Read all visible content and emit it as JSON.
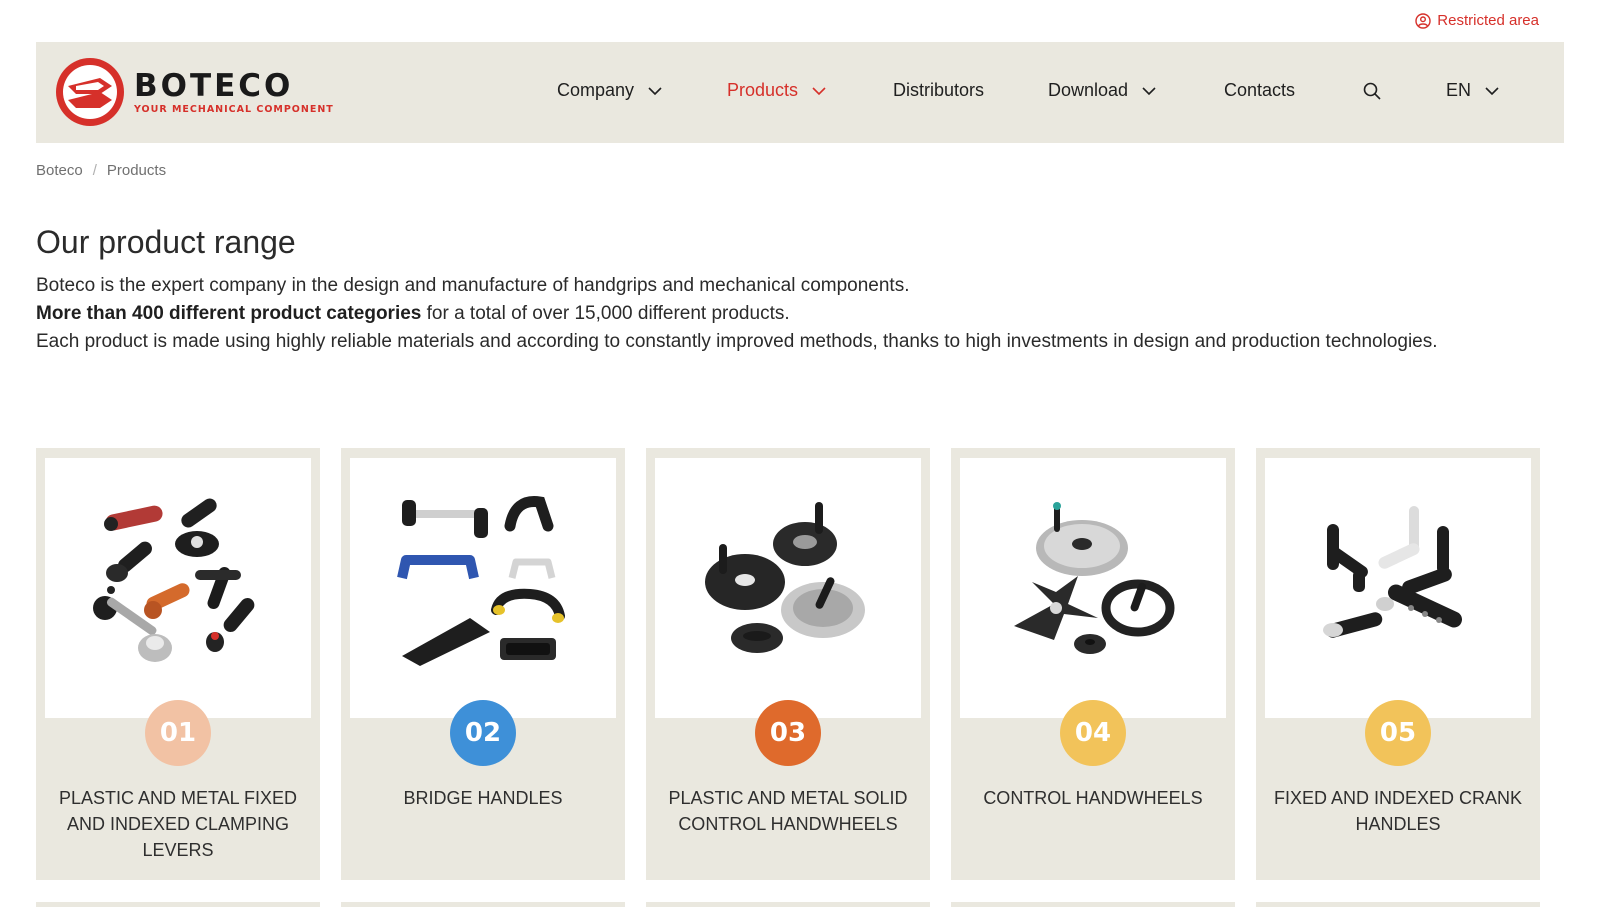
{
  "topbar": {
    "restricted_label": "Restricted area"
  },
  "brand": {
    "name": "BOTECO",
    "tagline": "YOUR MECHANICAL COMPONENT",
    "accent": "#d6302a"
  },
  "nav": {
    "company": "Company",
    "products": "Products",
    "distributors": "Distributors",
    "download": "Download",
    "contacts": "Contacts",
    "language": "EN"
  },
  "breadcrumb": {
    "home": "Boteco",
    "current": "Products"
  },
  "main": {
    "title": "Our product range",
    "intro_line1": "Boteco is the expert company in the design and manufacture of handgrips and mechanical components.",
    "intro_line2_bold": "More than 400 different product categories",
    "intro_line2_rest": " for a total of over 15,000 different products.",
    "intro_line3": "Each product is made using highly reliable materials and according to constantly improved methods, thanks to high investments in design and production technologies."
  },
  "products": [
    {
      "number": "01",
      "title": "PLASTIC AND METAL FIXED AND INDEXED CLAMPING LEVERS",
      "badge_color": "#f2c2a4"
    },
    {
      "number": "02",
      "title": "BRIDGE HANDLES",
      "badge_color": "#3e90d8"
    },
    {
      "number": "03",
      "title": "PLASTIC AND METAL SOLID CONTROL HANDWHEELS",
      "badge_color": "#df6a2c"
    },
    {
      "number": "04",
      "title": "CONTROL HANDWHEELS",
      "badge_color": "#f2c35a"
    },
    {
      "number": "05",
      "title": "FIXED AND INDEXED CRANK HANDLES",
      "badge_color": "#f2c35a"
    }
  ]
}
